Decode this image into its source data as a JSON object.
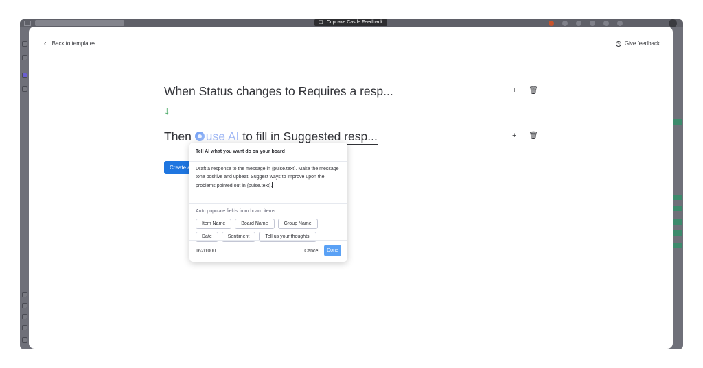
{
  "window": {
    "title": "Cupcake Castle Feedback",
    "title_icon": "sidebar-toggle-icon"
  },
  "modal": {
    "back_label": "Back to templates",
    "feedback_label": "Give feedback"
  },
  "automation": {
    "line1": {
      "when": "When",
      "field": "Status",
      "changes_to": "changes to",
      "value": "Requires a resp..."
    },
    "line2": {
      "then": "Then",
      "ai": "use AI",
      "fill_in": "to fill in",
      "target": "Suggested resp..."
    },
    "add_symbol": "+",
    "delete_symbol": "🗑",
    "create_label": "Create a"
  },
  "popover": {
    "header": "Tell AI what you want do on your board",
    "prompt": "Draft a response to the message in {pulse.text}. Make the message tone positive and upbeat. Suggest ways to improve upon the problems pointed out in {pulse.text}.",
    "hint": "Auto populate fields from board items",
    "chips_row1": [
      "Item Name",
      "Board Name",
      "Group Name"
    ],
    "chips_row2": [
      "Date",
      "Sentiment",
      "Tell us your thoughts!"
    ],
    "counter": "162/1000",
    "cancel": "Cancel",
    "done": "Done"
  }
}
